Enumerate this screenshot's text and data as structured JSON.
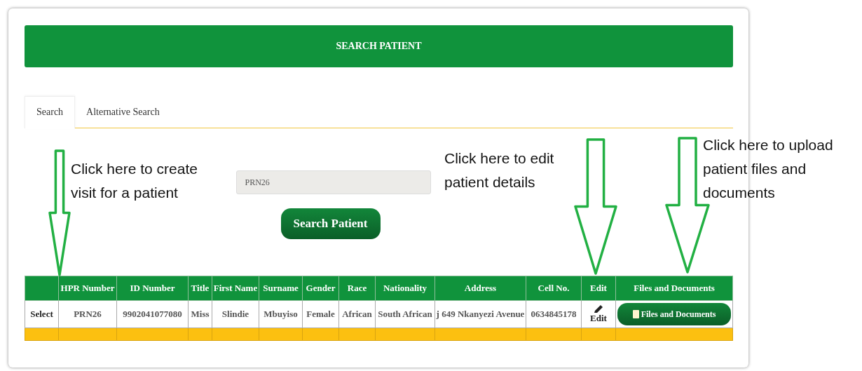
{
  "header": {
    "title": "SEARCH PATIENT"
  },
  "tabs": [
    {
      "label": "Search",
      "selected": true
    },
    {
      "label": "Alternative Search",
      "selected": false
    }
  ],
  "search": {
    "value": "PRN26",
    "button": "Search Patient"
  },
  "table": {
    "columns": [
      "",
      "HPR Number",
      "ID Number",
      "Title",
      "First Name",
      "Surname",
      "Gender",
      "Race",
      "Nationality",
      "Address",
      "Cell No.",
      "Edit",
      "Files and Documents"
    ],
    "rows": [
      [
        {
          "kind": "link",
          "text": "Select"
        },
        {
          "kind": "text",
          "text": "PRN26"
        },
        {
          "kind": "text",
          "text": "9902041077080"
        },
        {
          "kind": "text",
          "text": "Miss"
        },
        {
          "kind": "text",
          "text": "Slindie"
        },
        {
          "kind": "text",
          "text": "Mbuyiso"
        },
        {
          "kind": "text",
          "text": "Female"
        },
        {
          "kind": "text",
          "text": "African"
        },
        {
          "kind": "text",
          "text": "South African"
        },
        {
          "kind": "text",
          "text": "j 649 Nkanyezi Avenue"
        },
        {
          "kind": "text",
          "text": "0634845178"
        },
        {
          "kind": "edit",
          "text": "Edit"
        },
        {
          "kind": "button",
          "text": "Files and Documents"
        }
      ]
    ]
  },
  "annotations": [
    {
      "text": "Click here to create\nvisit for a patient"
    },
    {
      "text": "Click here to edit\npatient details"
    },
    {
      "text": "Click here to upload\npatient files and\ndocuments"
    }
  ]
}
